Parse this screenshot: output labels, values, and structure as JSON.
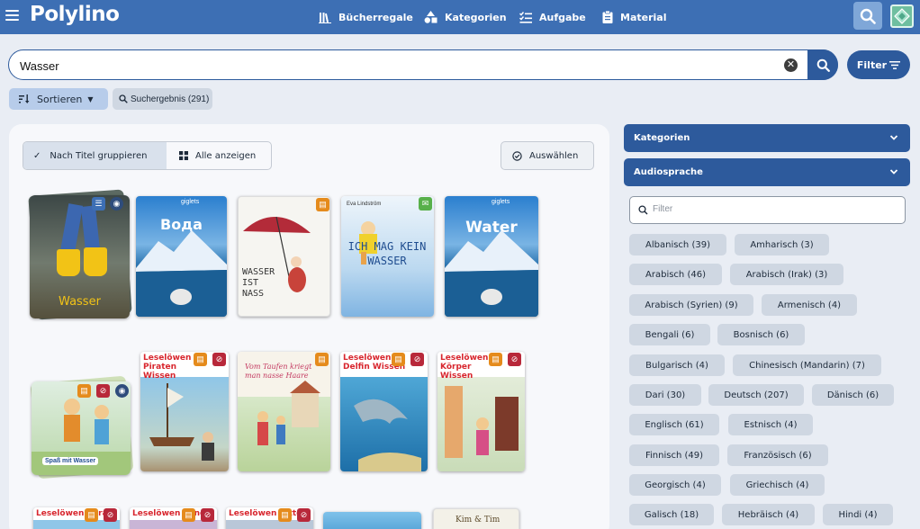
{
  "app": {
    "logo": "Polylino"
  },
  "nav": {
    "items": [
      {
        "label": "Bücherregale",
        "icon": "library-icon"
      },
      {
        "label": "Kategorien",
        "icon": "shapes-icon"
      },
      {
        "label": "Aufgabe",
        "icon": "checklist-icon"
      },
      {
        "label": "Material",
        "icon": "clipboard-icon"
      }
    ]
  },
  "search": {
    "value": "Wasser",
    "filter_label": "Filter"
  },
  "toolbar": {
    "sort_label": "Sortieren",
    "result_label": "Suchergebnis (291)"
  },
  "view": {
    "group_by_title_label": "Nach Titel gruppieren",
    "show_all_label": "Alle anzeigen",
    "select_label": "Auswählen"
  },
  "books": [
    {
      "title": "Wasser",
      "badges": [
        "checklist",
        "globe"
      ]
    },
    {
      "title": "Вода",
      "publisher": "giglets",
      "badges": []
    },
    {
      "title": "WASSER IST NASS",
      "badges": [
        "material"
      ]
    },
    {
      "title": "ICH MAG KEIN WASSER",
      "author": "Eva Lindström",
      "badges": [
        "chat"
      ]
    },
    {
      "title": "Water",
      "publisher": "giglets",
      "badges": []
    },
    {
      "title": "Spaß mit Wasser",
      "badges": [
        "material",
        "no-audio",
        "globe"
      ]
    },
    {
      "title": "Leselöwen Piraten Wissen",
      "badges": [
        "material",
        "no-audio"
      ]
    },
    {
      "title": "Vom Taufen kriegt man nasse Haare",
      "badges": [
        "material"
      ]
    },
    {
      "title": "Leselöwen Delfin Wissen",
      "badges": [
        "material",
        "no-audio"
      ]
    },
    {
      "title": "Leselöwen Körper Wissen",
      "badges": [
        "material",
        "no-audio"
      ]
    },
    {
      "title": "Leselöwen Pyramiden",
      "badges": [
        "material",
        "no-audio"
      ]
    },
    {
      "title": "Leselöwen Mineralien",
      "badges": [
        "material",
        "no-audio"
      ]
    },
    {
      "title": "Leselöwen Ritter",
      "badges": [
        "material",
        "no-audio"
      ]
    },
    {
      "title": "",
      "badges": []
    },
    {
      "title": "Kim & Tim",
      "badges": []
    }
  ],
  "sidebar": {
    "categories_label": "Kategorien",
    "audio_label": "Audiosprache",
    "filter_placeholder": "Filter",
    "languages": [
      "Albanisch (39)",
      "Amharisch (3)",
      "Arabisch (46)",
      "Arabisch (Irak) (3)",
      "Arabisch (Syrien) (9)",
      "Armenisch (4)",
      "Bengali (6)",
      "Bosnisch (6)",
      "Bulgarisch (4)",
      "Chinesisch (Mandarin) (7)",
      "Dari (30)",
      "Deutsch (207)",
      "Dänisch (6)",
      "Englisch (61)",
      "Estnisch (4)",
      "Finnisch (49)",
      "Französisch (6)",
      "Georgisch (4)",
      "Griechisch (4)",
      "Galisch (18)",
      "Hebräisch (4)",
      "Hindi (4)"
    ]
  },
  "colors": {
    "topbar": "#3d6fb4",
    "primary": "#2d5a9c",
    "chip": "#cfd7e2",
    "badge_orange": "#e58b1c",
    "badge_red": "#b8283a"
  }
}
